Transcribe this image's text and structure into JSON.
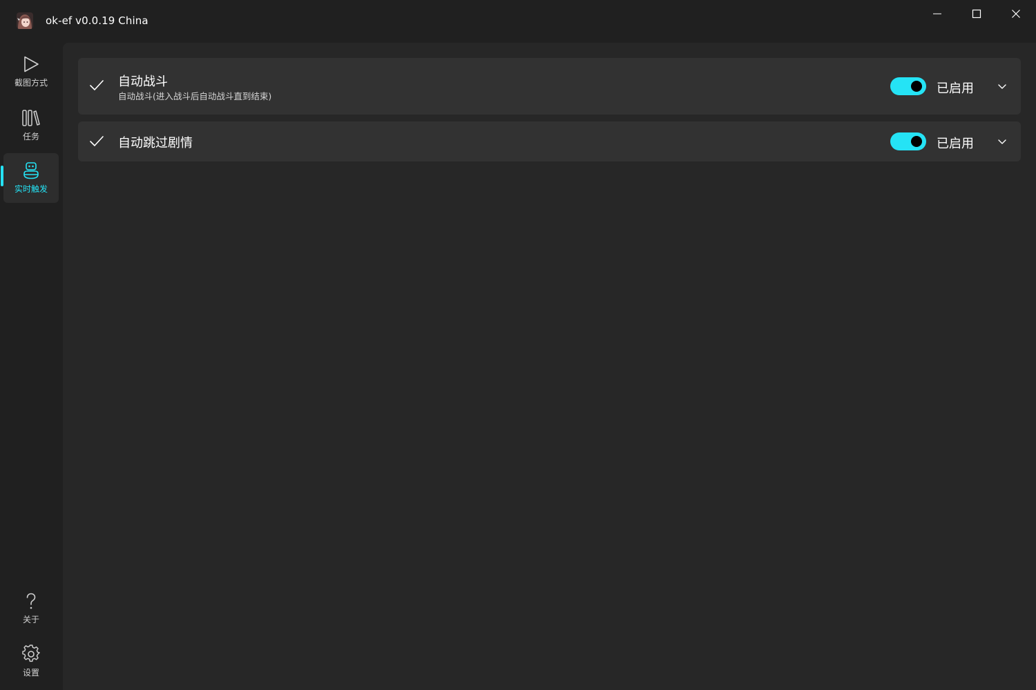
{
  "window": {
    "title": "ok-ef v0.0.19 China",
    "app_icon": "avatar-icon",
    "controls": [
      "minimize-icon",
      "maximize-icon",
      "close-icon"
    ]
  },
  "sidebar": {
    "items": [
      {
        "label": "截图方式",
        "icon": "play-icon",
        "active": false
      },
      {
        "label": "任务",
        "icon": "library-icon",
        "active": false
      },
      {
        "label": "实时触发",
        "icon": "robot-icon",
        "active": true
      }
    ],
    "bottom_items": [
      {
        "label": "关于",
        "icon": "question-icon"
      },
      {
        "label": "设置",
        "icon": "gear-icon"
      }
    ]
  },
  "triggers": [
    {
      "title": "自动战斗",
      "subtitle": "自动战斗(进入战斗后自动战斗直到结束)",
      "enabled": true,
      "status_label": "已启用"
    },
    {
      "title": "自动跳过剧情",
      "enabled": true,
      "status_label": "已启用"
    }
  ],
  "colors": {
    "accent": "#25e3f5",
    "background": "#202020",
    "panel": "#272727",
    "card": "#323232"
  }
}
